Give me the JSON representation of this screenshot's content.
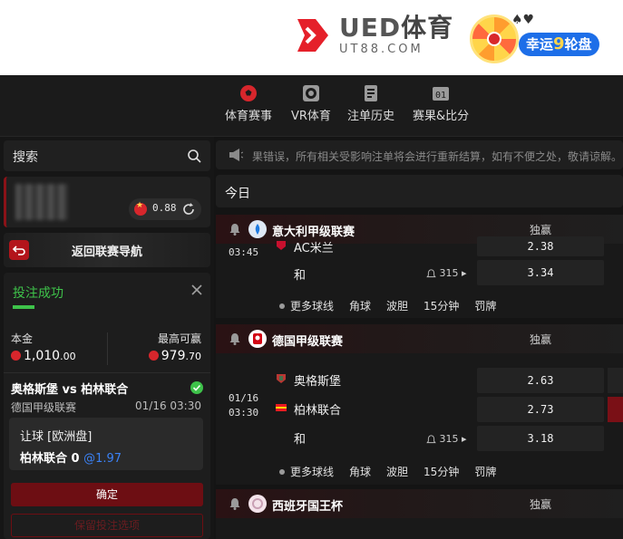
{
  "header": {
    "logo_main": "UED",
    "logo_zh": "体育",
    "logo_sub": "UT88.COM",
    "promo_label": "幸运",
    "promo_num": "9",
    "promo_suffix": "轮盘"
  },
  "nav": {
    "items": [
      {
        "label": "体育赛事",
        "icon": "soccer-ball-icon"
      },
      {
        "label": "VR体育",
        "icon": "vr-ball-icon"
      },
      {
        "label": "注单历史",
        "icon": "document-icon"
      },
      {
        "label": "赛果&比分",
        "icon": "scoreboard-icon"
      }
    ]
  },
  "sidebar": {
    "search_label": "搜索",
    "balance": "0.88",
    "back_label": "返回联赛导航",
    "bet": {
      "status": "投注成功",
      "stake_label": "本金",
      "maxwin_label": "最高可赢",
      "stake_int": "1,010",
      "stake_dec": ".00",
      "maxwin_int": "979",
      "maxwin_dec": ".70",
      "match": "奥格斯堡 vs 柏林联合",
      "league": "德国甲级联赛",
      "time": "01/16 03:30",
      "market": "让球 [欧洲盘]",
      "pick": "柏林联合 0",
      "odds": "@1.97",
      "confirm_label": "确定",
      "keep_label": "保留投注选项"
    }
  },
  "main": {
    "notice": "果错误，所有相关受影响注单将会进行重新结算，如有不便之处，敬请谅解。",
    "today_label": "今日",
    "leagues": [
      {
        "name": "意大利甲级联赛",
        "col": "独赢",
        "time": "03:45",
        "team_partial": "AC米兰",
        "odds_partial": "2.38",
        "draw_label": "和",
        "stream_count": "315",
        "draw_odds": "3.34",
        "markets": [
          "更多球线",
          "角球",
          "波胆",
          "15分钟",
          "罚牌"
        ]
      },
      {
        "name": "德国甲级联赛",
        "col": "独赢",
        "date": "01/16",
        "time": "03:30",
        "home": "奥格斯堡",
        "away": "柏林联合",
        "home_odds": "2.63",
        "away_odds": "2.73",
        "draw_label": "和",
        "stream_count": "315",
        "draw_odds": "3.18",
        "markets": [
          "更多球线",
          "角球",
          "波胆",
          "15分钟",
          "罚牌"
        ]
      },
      {
        "name": "西班牙国王杯",
        "col": "独赢"
      }
    ]
  },
  "colors": {
    "accent_red": "#b3141b",
    "success_green": "#3ec24a",
    "odds_blue": "#3b82f6",
    "brand_red": "#e5202a"
  }
}
